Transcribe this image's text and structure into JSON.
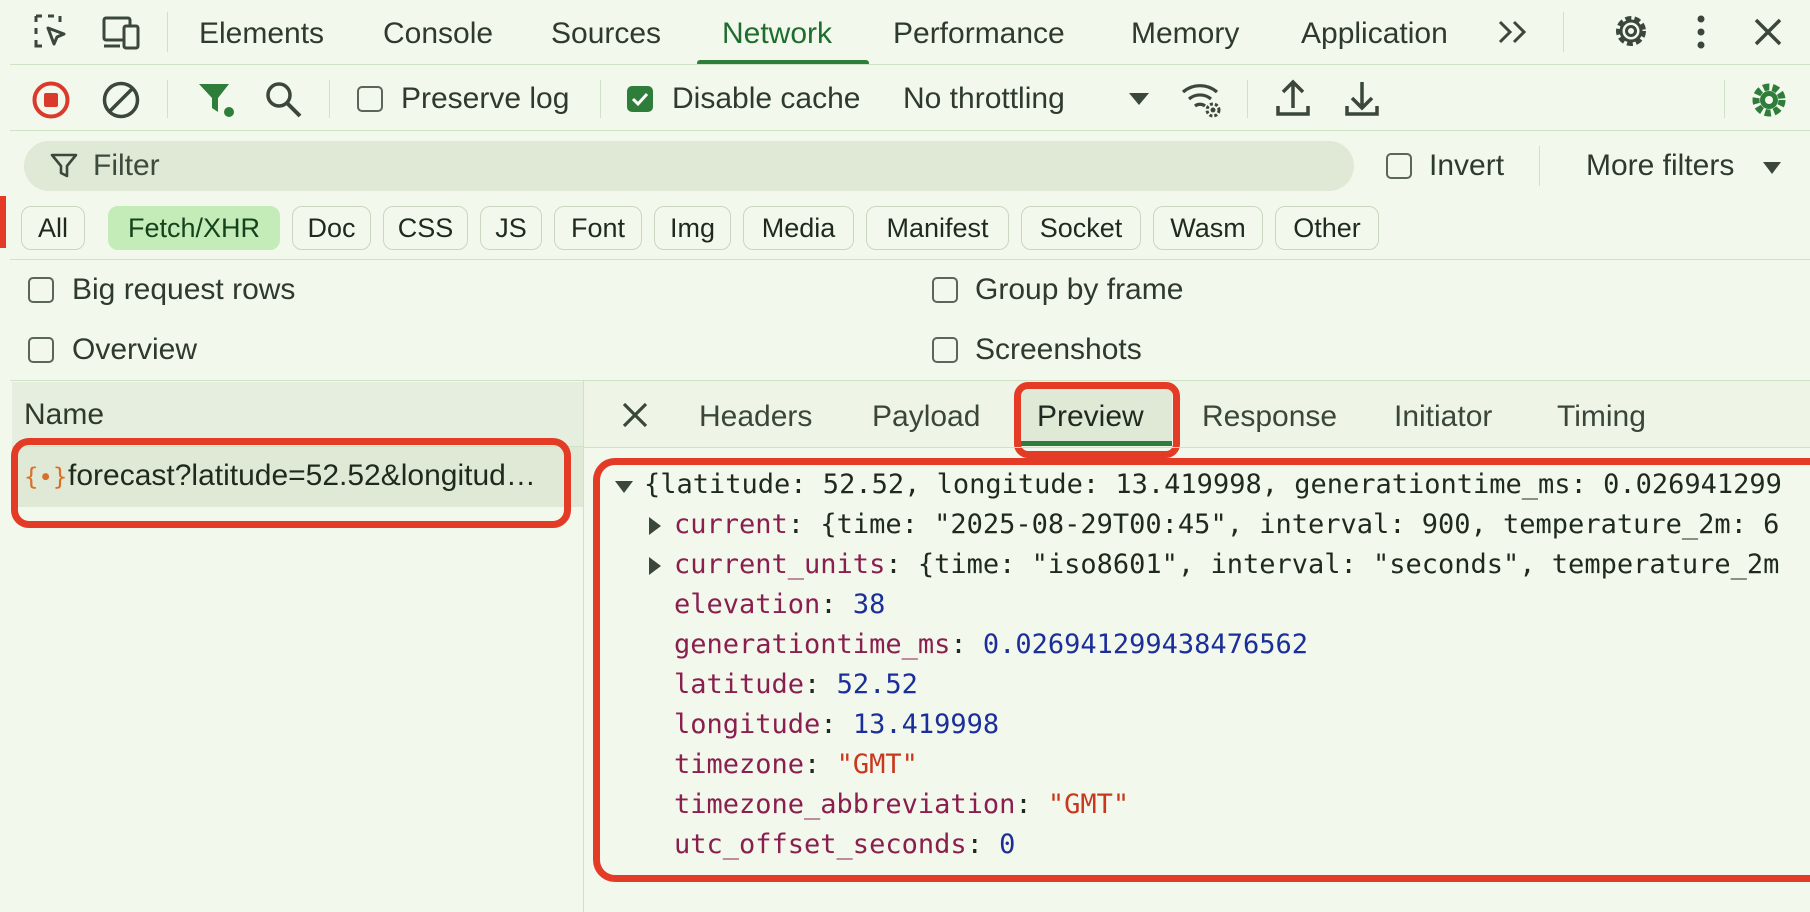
{
  "top_tabs": [
    "Elements",
    "Console",
    "Sources",
    "Network",
    "Performance",
    "Memory",
    "Application"
  ],
  "active_tab": "Network",
  "toolbar": {
    "preserve_log": "Preserve log",
    "disable_cache": "Disable cache",
    "throttling": "No throttling"
  },
  "filter": {
    "placeholder": "Filter",
    "invert": "Invert",
    "more_filters": "More filters"
  },
  "type_filters": [
    "All",
    "Fetch/XHR",
    "Doc",
    "CSS",
    "JS",
    "Font",
    "Img",
    "Media",
    "Manifest",
    "Socket",
    "Wasm",
    "Other"
  ],
  "active_type": "Fetch/XHR",
  "options": {
    "big_rows": "Big request rows",
    "group_frame": "Group by frame",
    "overview": "Overview",
    "screenshots": "Screenshots"
  },
  "requests": {
    "header": "Name",
    "items": [
      {
        "name": "forecast?latitude=52.52&longitud…"
      }
    ]
  },
  "details_tabs": [
    "Headers",
    "Payload",
    "Preview",
    "Response",
    "Initiator",
    "Timing"
  ],
  "active_details_tab": "Preview",
  "preview": {
    "root_summary": "{latitude: 52.52, longitude: 13.419998, generationtime_ms: 0.026941299",
    "current_key": "current",
    "current_summary": "{time: \"2025-08-29T00:45\", interval: 900, temperature_2m: 6",
    "current_units_key": "current_units",
    "current_units_summary": "{time: \"iso8601\", interval: \"seconds\", temperature_2m",
    "fields": [
      {
        "key": "elevation",
        "value": "38",
        "kind": "n"
      },
      {
        "key": "generationtime_ms",
        "value": "0.026941299438476562",
        "kind": "n"
      },
      {
        "key": "latitude",
        "value": "52.52",
        "kind": "n"
      },
      {
        "key": "longitude",
        "value": "13.419998",
        "kind": "n"
      },
      {
        "key": "timezone",
        "value": "\"GMT\"",
        "kind": "s"
      },
      {
        "key": "timezone_abbreviation",
        "value": "\"GMT\"",
        "kind": "s"
      },
      {
        "key": "utc_offset_seconds",
        "value": "0",
        "kind": "n"
      }
    ]
  },
  "colors": {
    "accent": "#2f7d3a",
    "highlight": "#e33b26",
    "chip_active": "#c3ecb8"
  }
}
